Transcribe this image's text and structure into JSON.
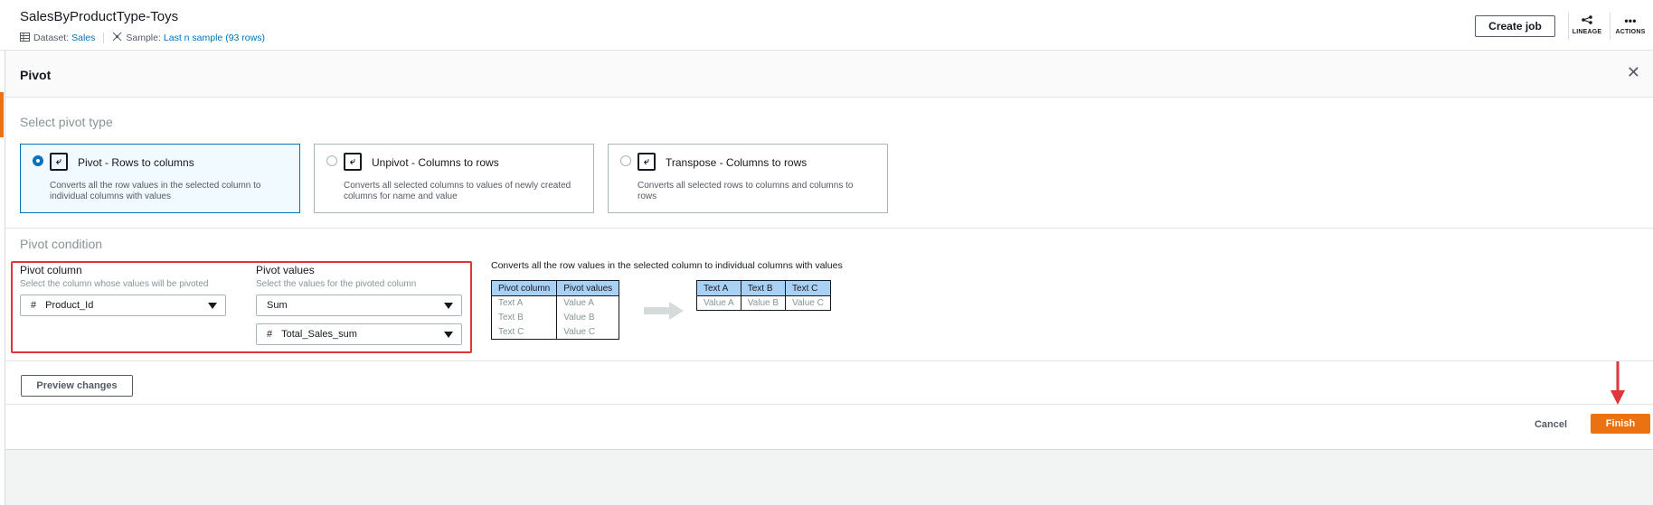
{
  "header": {
    "title": "SalesByProductType-Toys",
    "dataset_label": "Dataset:",
    "dataset_value": "Sales",
    "sample_label": "Sample:",
    "sample_value": "Last n sample (93 rows)",
    "create_job_label": "Create job",
    "lineage_label": "LINEAGE",
    "actions_label": "ACTIONS"
  },
  "panel": {
    "title": "Pivot",
    "select_type_label": "Select pivot type",
    "cards": [
      {
        "title": "Pivot - Rows to columns",
        "desc": "Converts all the row values in the selected column to individual columns with values",
        "selected": true
      },
      {
        "title": "Unpivot - Columns to rows",
        "desc": "Converts all selected columns to values of newly created columns for name and value",
        "selected": false
      },
      {
        "title": "Transpose - Columns to rows",
        "desc": "Converts all selected rows to columns and columns to rows",
        "selected": false
      }
    ],
    "condition_label": "Pivot condition",
    "pivot_column": {
      "label": "Pivot column",
      "desc": "Select the column whose values will be pivoted",
      "value": "Product_Id"
    },
    "pivot_values": {
      "label": "Pivot values",
      "desc": "Select the values for the pivoted column",
      "aggregate": "Sum",
      "column": "Total_Sales_sum"
    },
    "explanation": "Converts all the row values in the selected column to individual columns with values",
    "example_before": {
      "headers": [
        "Pivot column",
        "Pivot values"
      ],
      "rows": [
        [
          "Text A",
          "Value A"
        ],
        [
          "Text B",
          "Value B"
        ],
        [
          "Text C",
          "Value C"
        ]
      ]
    },
    "example_after": {
      "headers": [
        "Text A",
        "Text B",
        "Text C"
      ],
      "row": [
        "Value A",
        "Value B",
        "Value C"
      ]
    },
    "preview_label": "Preview changes",
    "cancel_label": "Cancel",
    "finish_label": "Finish"
  },
  "colors": {
    "accent_orange": "#ec7211",
    "selection_blue": "#0073bb",
    "annotation_red": "#e0353d"
  }
}
